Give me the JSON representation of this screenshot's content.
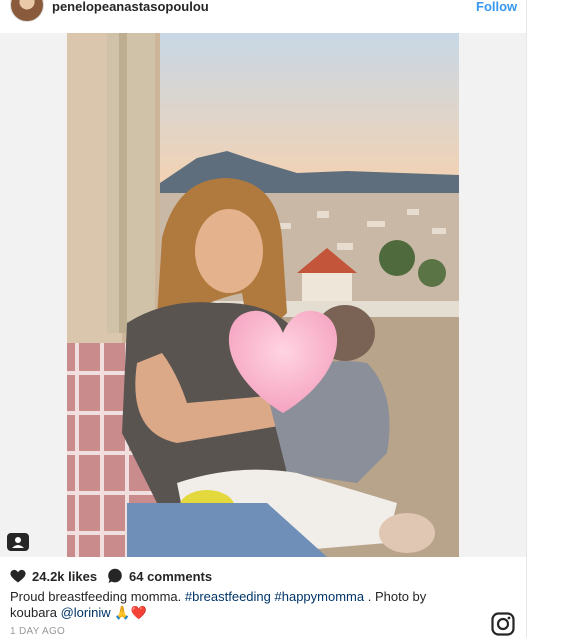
{
  "post": {
    "username": "penelopeanastasopoulou",
    "follow_label": "Follow",
    "likes": "24.2k likes",
    "comments": "64 comments",
    "caption": {
      "text_start": "Proud breastfeeding momma. ",
      "hashtag1": "#breastfeeding",
      "hashtag2": "#happymomma",
      "text_mid": " . Photo by",
      "text_line2": "koubara ",
      "mention": "@loriniw",
      "emoji": " 🙏❤️"
    },
    "timestamp": "1 DAY AGO"
  },
  "icons": {
    "like": "heart-icon",
    "comment": "comment-bubble-icon",
    "user_tag": "person-tag-icon",
    "brand": "instagram-icon"
  },
  "colors": {
    "link": "#3897f0",
    "hashtag": "#003569",
    "text": "#262626",
    "muted": "#999999"
  }
}
